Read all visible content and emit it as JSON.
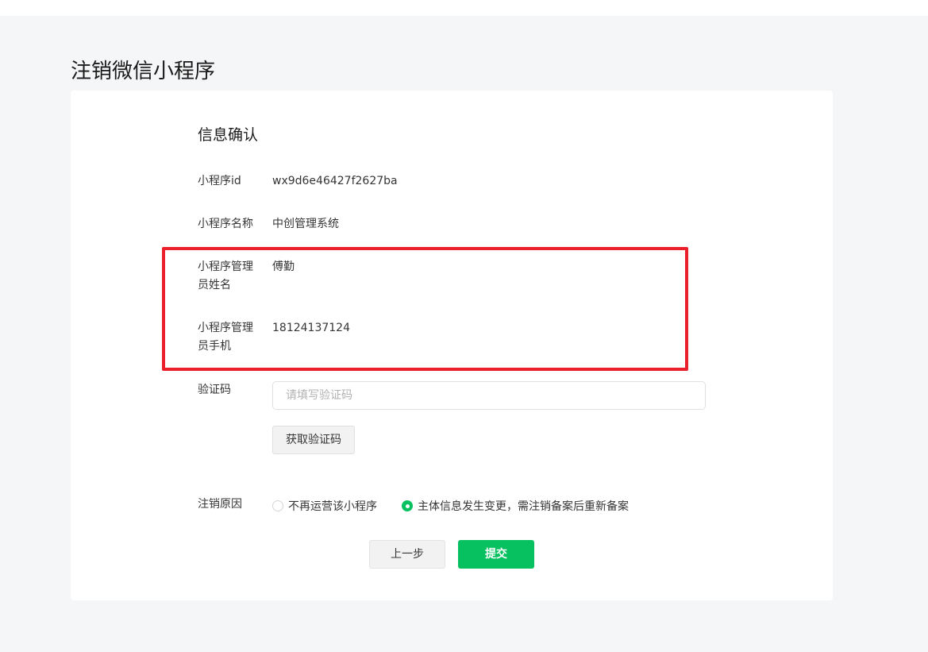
{
  "page": {
    "title": "注销微信小程序"
  },
  "section": {
    "title": "信息确认"
  },
  "fields": {
    "appid_label": "小程序id",
    "appid_value": "wx9d6e46427f2627ba",
    "name_label": "小程序名称",
    "name_value": "中创管理系统",
    "admin_name_label": "小程序管理员姓名",
    "admin_name_value": "傅勤",
    "admin_phone_label": "小程序管理员手机",
    "admin_phone_value": "18124137124",
    "code_label": "验证码"
  },
  "code_input": {
    "placeholder": "请填写验证码",
    "value": ""
  },
  "get_code_button": "获取验证码",
  "reason": {
    "label": "注销原因",
    "options": [
      {
        "label": "不再运营该小程序",
        "checked": false
      },
      {
        "label": "主体信息发生变更，需注销备案后重新备案",
        "checked": true
      }
    ]
  },
  "actions": {
    "prev_label": "上一步",
    "submit_label": "提交"
  },
  "colors": {
    "accent": "#07c160",
    "highlight_border": "#ea1f2b",
    "background": "#f5f6f7"
  }
}
